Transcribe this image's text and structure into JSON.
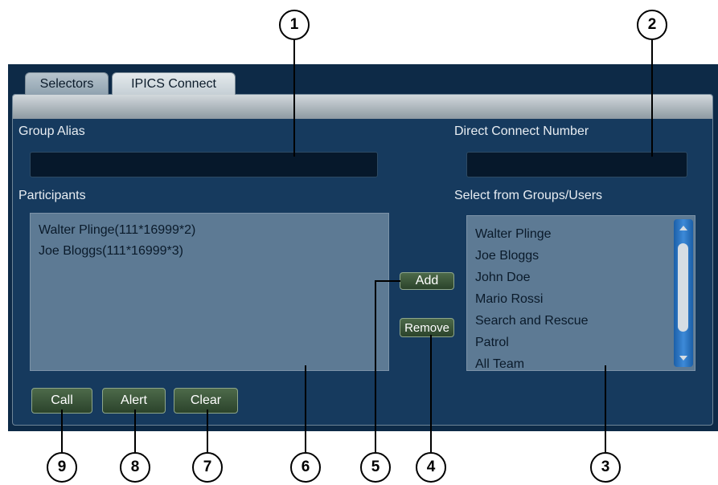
{
  "tabs": [
    {
      "label": "Selectors"
    },
    {
      "label": "IPICS Connect"
    }
  ],
  "group_alias": {
    "label": "Group Alias",
    "value": ""
  },
  "direct_connect": {
    "label": "Direct Connect Number",
    "value": ""
  },
  "participants": {
    "label": "Participants",
    "items": [
      "Walter Plinge(111*16999*2)",
      "Joe Bloggs(111*16999*3)"
    ]
  },
  "select_from": {
    "label": "Select from Groups/Users",
    "items": [
      "Walter Plinge",
      "Joe Bloggs",
      "John Doe",
      "Mario Rossi",
      "Search and Rescue",
      "Patrol",
      "All Team"
    ]
  },
  "buttons": {
    "add": "Add",
    "remove": "Remove",
    "call": "Call",
    "alert": "Alert",
    "clear": "Clear"
  },
  "callouts": [
    "1",
    "2",
    "3",
    "4",
    "5",
    "6",
    "7",
    "8",
    "9"
  ]
}
